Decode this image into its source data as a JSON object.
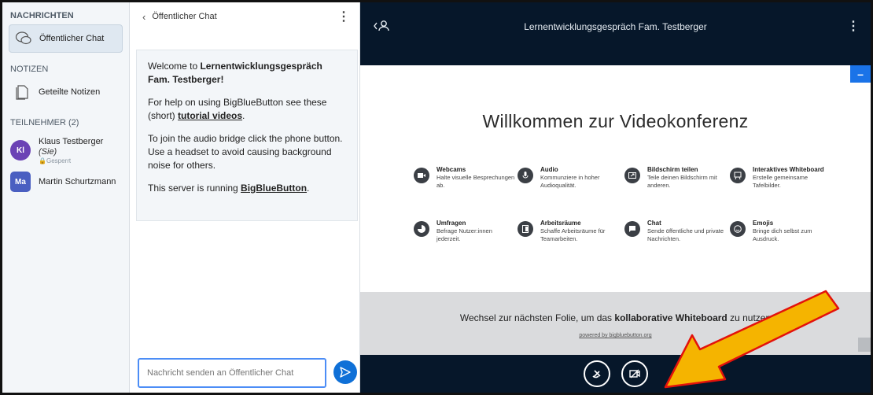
{
  "sidebar": {
    "messages_title": "NACHRICHTEN",
    "public_chat": "Öffentlicher Chat",
    "notes_title": "NOTIZEN",
    "shared_notes": "Geteilte Notizen",
    "participants_title": "TEILNEHMER (2)",
    "users": [
      {
        "initials": "Kl",
        "name": "Klaus Testberger",
        "tag": "(Sie)",
        "status": "Gesperrt"
      },
      {
        "initials": "Ma",
        "name": "Martin Schurtzmann"
      }
    ]
  },
  "chat": {
    "header_title": "Öffentlicher Chat",
    "welcome_prefix": "Welcome to ",
    "welcome_name": "Lernentwicklungsgespräch Fam. Testberger",
    "welcome_suffix": "!",
    "help_prefix": "For help on using BigBlueButton see these (short) ",
    "help_link": "tutorial videos",
    "help_suffix": ".",
    "audio_text": "To join the audio bridge click the phone button. Use a headset to avoid causing background noise for others.",
    "server_prefix": "This server is running ",
    "server_link": "BigBlueButton",
    "server_suffix": ".",
    "input_placeholder": "Nachricht senden an Öffentlicher Chat"
  },
  "main": {
    "title": "Lernentwicklungsgespräch Fam. Testberger",
    "minimize_label": "–",
    "slide_title": "Willkommen zur Videokonferenz",
    "features": [
      {
        "title": "Webcams",
        "desc": "Halte visuelle Besprechungen ab.",
        "icon": "webcam-icon"
      },
      {
        "title": "Audio",
        "desc": "Kommunziere in hoher Audioqualität.",
        "icon": "microphone-icon"
      },
      {
        "title": "Bildschirm teilen",
        "desc": "Teile deinen Bildschirm mit anderen.",
        "icon": "screenshare-icon"
      },
      {
        "title": "Interaktives Whiteboard",
        "desc": "Erstelle gemeinsame Tafelbilder.",
        "icon": "whiteboard-icon"
      },
      {
        "title": "Umfragen",
        "desc": "Befrage Nutzer:innen jederzeit.",
        "icon": "poll-icon"
      },
      {
        "title": "Arbeitsräume",
        "desc": "Schaffe Arbeitsräume für Teamarbeiten.",
        "icon": "breakout-icon"
      },
      {
        "title": "Chat",
        "desc": "Sende öffentliche und private Nachrichten.",
        "icon": "chat-icon"
      },
      {
        "title": "Emojis",
        "desc": "Bringe dich selbst zum Ausdruck.",
        "icon": "emoji-icon"
      }
    ],
    "footer_prefix": "Wechsel zur nächsten Folie, um das ",
    "footer_bold": "kollaborative Whiteboard",
    "footer_suffix": " zu nutzen",
    "footer_sub": "powered by bigbluebutton.org"
  },
  "colors": {
    "accent": "#0f70d7",
    "main_bg": "#06172a",
    "arrow": "#f5b400"
  }
}
